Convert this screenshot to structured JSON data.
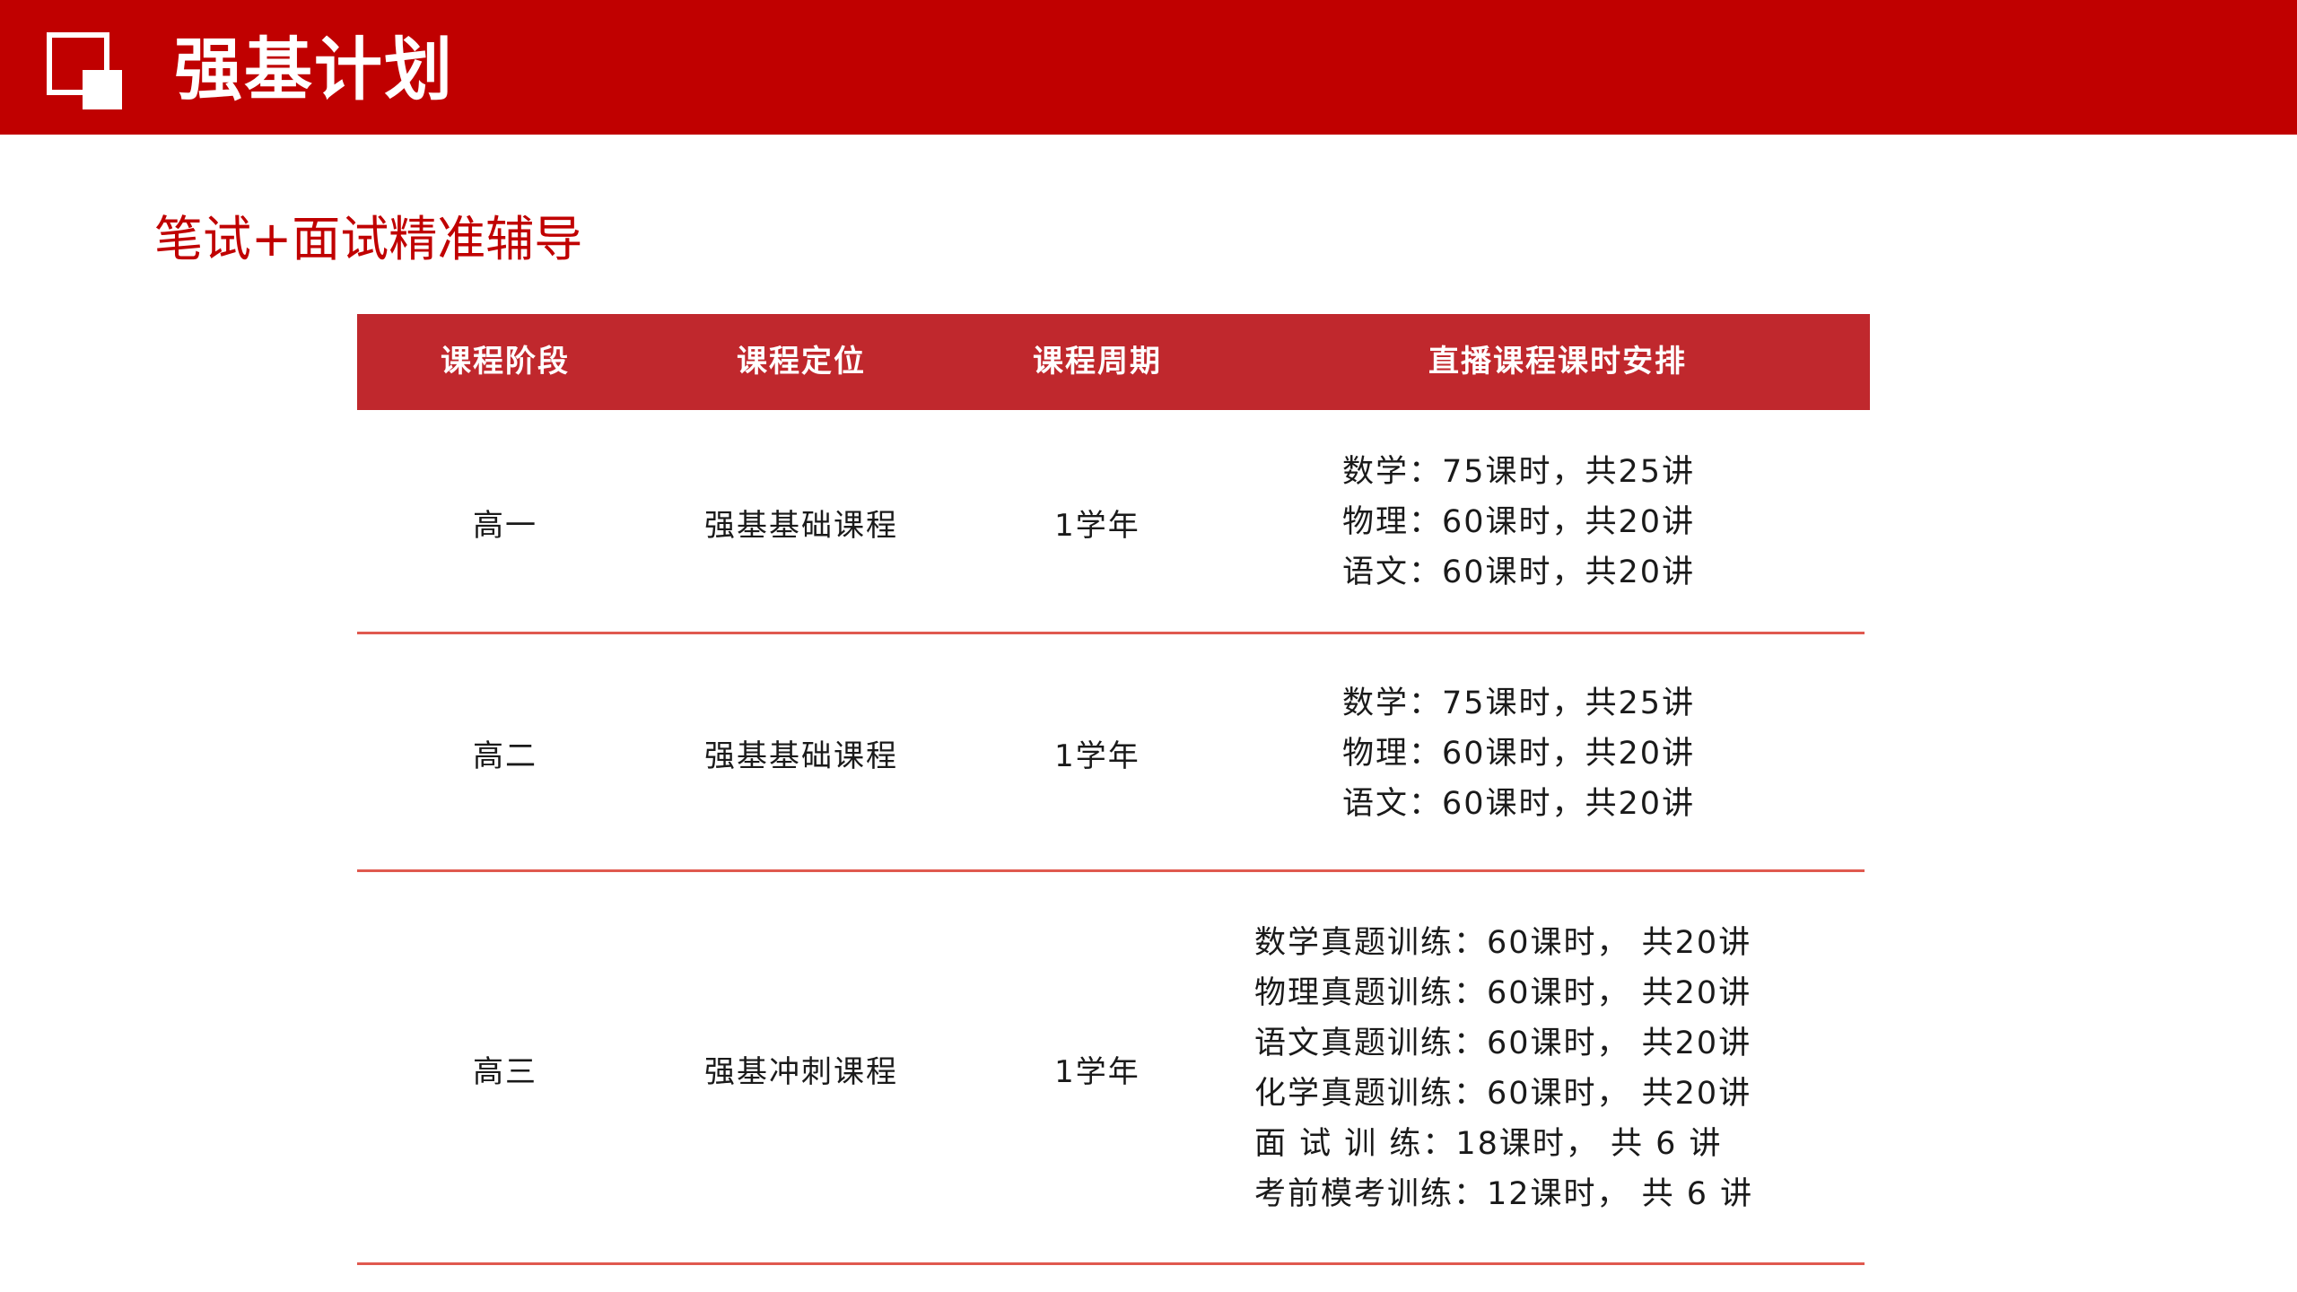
{
  "header": {
    "title": "强基计划",
    "logo_icon": "square-overlap-icon",
    "background_color": "#c00000"
  },
  "subtitle": "笔试+面试精准辅导",
  "table": {
    "columns": [
      "课程阶段",
      "课程定位",
      "课程周期",
      "直播课程课时安排"
    ],
    "rows": [
      {
        "stage": "高一",
        "position": "强基基础课程",
        "period": "1学年",
        "schedule": [
          "数学：75课时，共25讲",
          "物理：60课时，共20讲",
          "语文：60课时，共20讲"
        ]
      },
      {
        "stage": "高二",
        "position": "强基基础课程",
        "period": "1学年",
        "schedule": [
          "数学：75课时，共25讲",
          "物理：60课时，共20讲",
          "语文：60课时，共20讲"
        ]
      },
      {
        "stage": "高三",
        "position": "强基冲刺课程",
        "period": "1学年",
        "schedule": [
          "数学真题训练：60课时， 共20讲",
          "物理真题训练：60课时， 共20讲",
          "语文真题训练：60课时， 共20讲",
          "化学真题训练：60课时， 共20讲",
          "面 试 训 练：18课时， 共 6 讲",
          "考前模考训练：12课时， 共 6 讲"
        ]
      }
    ],
    "header_color": "#c0282d",
    "divider_color": "#e0594f"
  }
}
